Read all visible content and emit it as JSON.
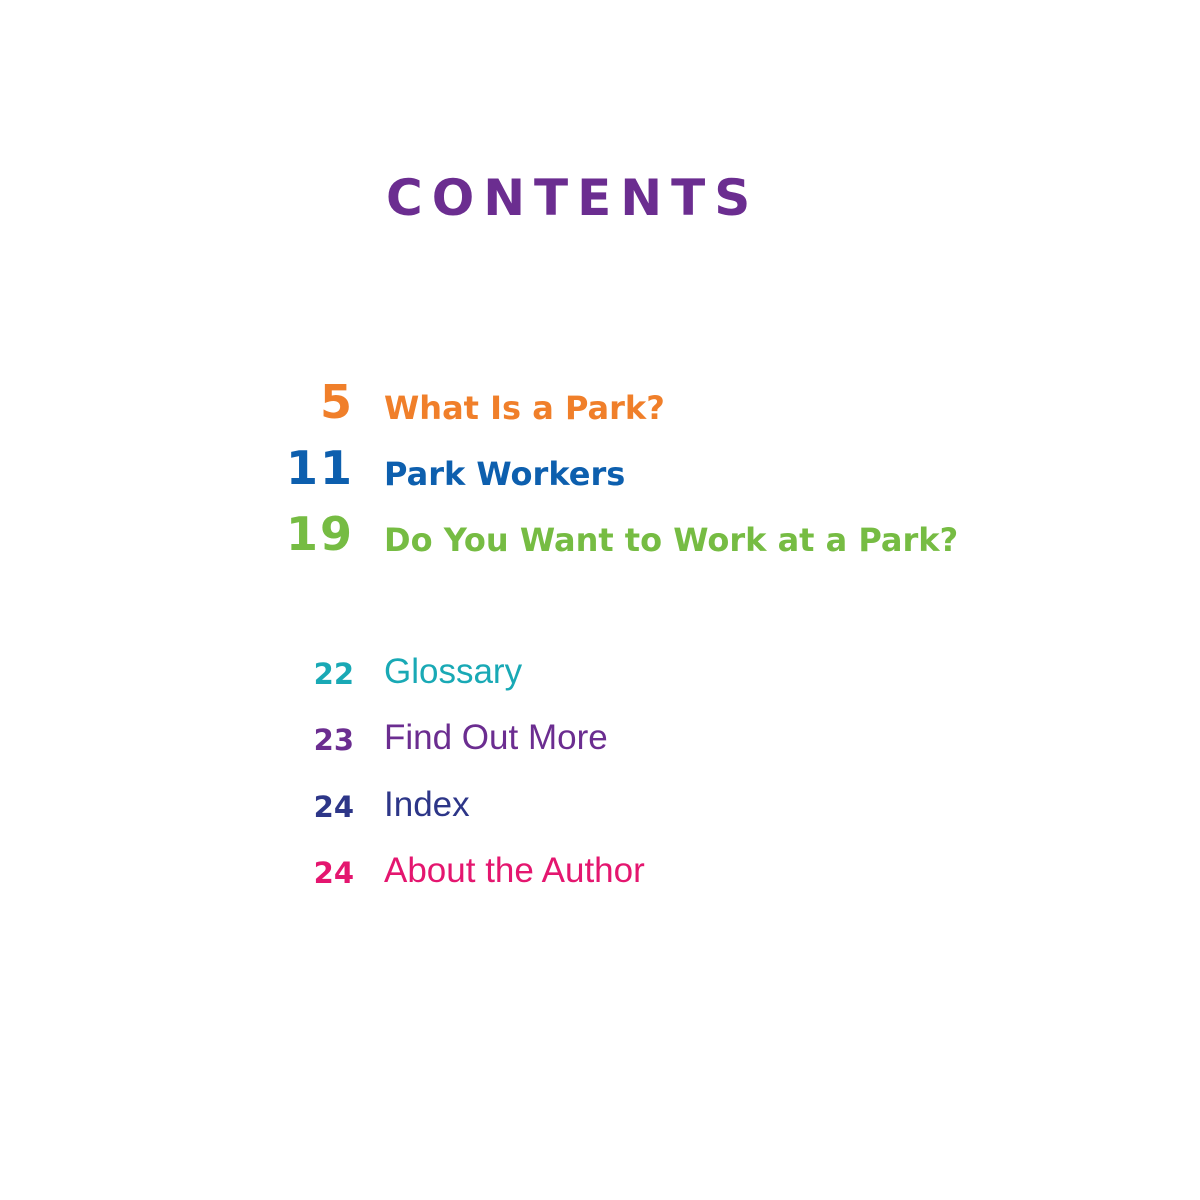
{
  "title": {
    "text": "CONTENTS",
    "color": "#6b2d90"
  },
  "chapters": [
    {
      "page": "5",
      "label": "What Is a Park?",
      "color": "#f07f2a"
    },
    {
      "page": "11",
      "label": "Park Workers",
      "color": "#0d5fae"
    },
    {
      "page": "19",
      "label": "Do You Want to Work at a Park?",
      "color": "#76bc43"
    }
  ],
  "back_matter": [
    {
      "page": "22",
      "label": "Glossary",
      "color": "#19a9b5"
    },
    {
      "page": "23",
      "label": "Find Out More",
      "color": "#6b2d90"
    },
    {
      "page": "24",
      "label": "Index",
      "color": "#2d3688"
    },
    {
      "page": "24",
      "label": "About the Author",
      "color": "#e4166f"
    }
  ]
}
